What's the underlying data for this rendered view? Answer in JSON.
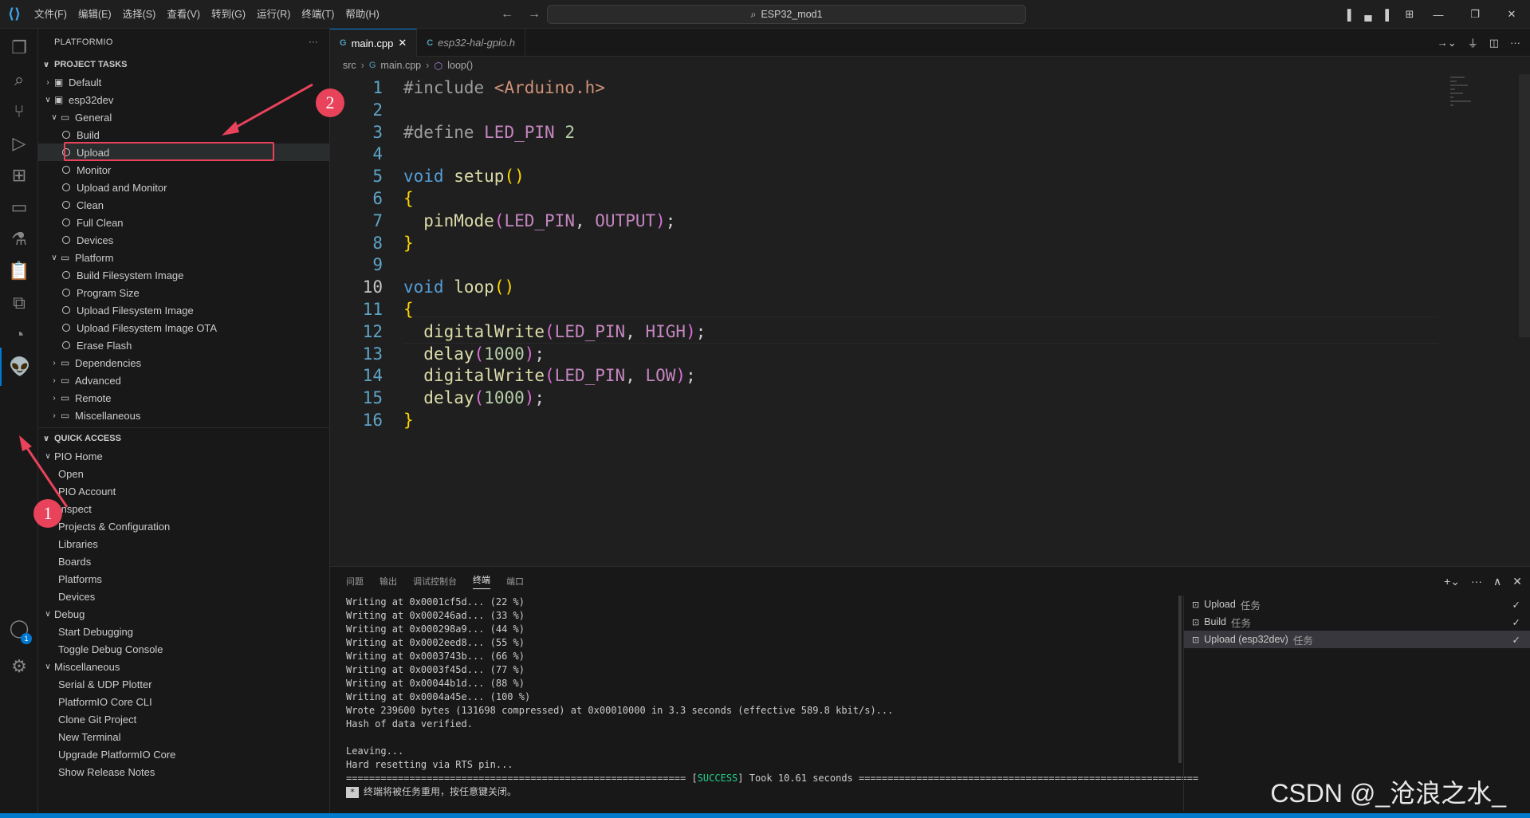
{
  "titlebar": {
    "menu": [
      "文件(F)",
      "编辑(E)",
      "选择(S)",
      "查看(V)",
      "转到(G)",
      "运行(R)",
      "终端(T)",
      "帮助(H)"
    ],
    "search": "ESP32_mod1"
  },
  "sidebar": {
    "header": "PLATFORMIO",
    "project_tasks": {
      "title": "PROJECT TASKS",
      "items": [
        {
          "label": "Default",
          "level": 1,
          "type": "env",
          "expanded": false
        },
        {
          "label": "esp32dev",
          "level": 1,
          "type": "env",
          "expanded": true
        },
        {
          "label": "General",
          "level": 2,
          "type": "folder",
          "expanded": true
        },
        {
          "label": "Build",
          "level": 3,
          "type": "task"
        },
        {
          "label": "Upload",
          "level": 3,
          "type": "task",
          "selected": true
        },
        {
          "label": "Monitor",
          "level": 3,
          "type": "task"
        },
        {
          "label": "Upload and Monitor",
          "level": 3,
          "type": "task"
        },
        {
          "label": "Clean",
          "level": 3,
          "type": "task"
        },
        {
          "label": "Full Clean",
          "level": 3,
          "type": "task"
        },
        {
          "label": "Devices",
          "level": 3,
          "type": "task"
        },
        {
          "label": "Platform",
          "level": 2,
          "type": "folder",
          "expanded": true
        },
        {
          "label": "Build Filesystem Image",
          "level": 3,
          "type": "task"
        },
        {
          "label": "Program Size",
          "level": 3,
          "type": "task"
        },
        {
          "label": "Upload Filesystem Image",
          "level": 3,
          "type": "task"
        },
        {
          "label": "Upload Filesystem Image OTA",
          "level": 3,
          "type": "task"
        },
        {
          "label": "Erase Flash",
          "level": 3,
          "type": "task"
        },
        {
          "label": "Dependencies",
          "level": 2,
          "type": "folder",
          "expanded": false
        },
        {
          "label": "Advanced",
          "level": 2,
          "type": "folder",
          "expanded": false
        },
        {
          "label": "Remote",
          "level": 2,
          "type": "folder",
          "expanded": false
        },
        {
          "label": "Miscellaneous",
          "level": 2,
          "type": "folder",
          "expanded": false
        }
      ]
    },
    "quick_access": {
      "title": "QUICK ACCESS",
      "groups": [
        {
          "label": "PIO Home",
          "items": [
            "Open",
            "PIO Account",
            "Inspect",
            "Projects & Configuration",
            "Libraries",
            "Boards",
            "Platforms",
            "Devices"
          ]
        },
        {
          "label": "Debug",
          "items": [
            "Start Debugging",
            "Toggle Debug Console"
          ]
        },
        {
          "label": "Miscellaneous",
          "items": [
            "Serial & UDP Plotter",
            "PlatformIO Core CLI",
            "Clone Git Project",
            "New Terminal",
            "Upgrade PlatformIO Core",
            "Show Release Notes"
          ]
        }
      ]
    }
  },
  "tabs": [
    {
      "label": "main.cpp",
      "active": true,
      "icon": "G"
    },
    {
      "label": "esp32-hal-gpio.h",
      "active": false,
      "icon": "C"
    }
  ],
  "breadcrumb": [
    "src",
    "main.cpp",
    "loop()"
  ],
  "code": [
    {
      "n": "1",
      "tokens": [
        [
          "pre",
          "#include "
        ],
        [
          "str",
          "<Arduino.h>"
        ]
      ]
    },
    {
      "n": "2",
      "tokens": []
    },
    {
      "n": "3",
      "tokens": [
        [
          "pre",
          "#define "
        ],
        [
          "macro",
          "LED_PIN"
        ],
        [
          "id",
          " "
        ],
        [
          "num",
          "2"
        ]
      ]
    },
    {
      "n": "4",
      "tokens": []
    },
    {
      "n": "5",
      "tokens": [
        [
          "kw",
          "void"
        ],
        [
          "id",
          " "
        ],
        [
          "fn",
          "setup"
        ],
        [
          "br",
          "()"
        ]
      ]
    },
    {
      "n": "6",
      "tokens": [
        [
          "br",
          "{"
        ]
      ]
    },
    {
      "n": "7",
      "tokens": [
        [
          "id",
          "  "
        ],
        [
          "fn",
          "pinMode"
        ],
        [
          "br2",
          "("
        ],
        [
          "macro",
          "LED_PIN"
        ],
        [
          "id",
          ", "
        ],
        [
          "macro",
          "OUTPUT"
        ],
        [
          "br2",
          ")"
        ],
        [
          "id",
          ";"
        ]
      ]
    },
    {
      "n": "8",
      "tokens": [
        [
          "br",
          "}"
        ]
      ]
    },
    {
      "n": "9",
      "tokens": []
    },
    {
      "n": "10",
      "tokens": [
        [
          "kw",
          "void"
        ],
        [
          "id",
          " "
        ],
        [
          "fn",
          "loop"
        ],
        [
          "br",
          "()"
        ]
      ],
      "current": true
    },
    {
      "n": "11",
      "tokens": [
        [
          "br",
          "{"
        ]
      ]
    },
    {
      "n": "12",
      "tokens": [
        [
          "id",
          "  "
        ],
        [
          "fn",
          "digitalWrite"
        ],
        [
          "br2",
          "("
        ],
        [
          "macro",
          "LED_PIN"
        ],
        [
          "id",
          ", "
        ],
        [
          "macro",
          "HIGH"
        ],
        [
          "br2",
          ")"
        ],
        [
          "id",
          ";"
        ]
      ]
    },
    {
      "n": "13",
      "tokens": [
        [
          "id",
          "  "
        ],
        [
          "fn",
          "delay"
        ],
        [
          "br2",
          "("
        ],
        [
          "num",
          "1000"
        ],
        [
          "br2",
          ")"
        ],
        [
          "id",
          ";"
        ]
      ]
    },
    {
      "n": "14",
      "tokens": [
        [
          "id",
          "  "
        ],
        [
          "fn",
          "digitalWrite"
        ],
        [
          "br2",
          "("
        ],
        [
          "macro",
          "LED_PIN"
        ],
        [
          "id",
          ", "
        ],
        [
          "macro",
          "LOW"
        ],
        [
          "br2",
          ")"
        ],
        [
          "id",
          ";"
        ]
      ]
    },
    {
      "n": "15",
      "tokens": [
        [
          "id",
          "  "
        ],
        [
          "fn",
          "delay"
        ],
        [
          "br2",
          "("
        ],
        [
          "num",
          "1000"
        ],
        [
          "br2",
          ")"
        ],
        [
          "id",
          ";"
        ]
      ]
    },
    {
      "n": "16",
      "tokens": [
        [
          "br",
          "}"
        ]
      ]
    }
  ],
  "panel": {
    "tabs": [
      "问题",
      "输出",
      "调试控制台",
      "终端",
      "端口"
    ],
    "active_tab": "终端",
    "terminal_lines": [
      "Writing at 0x0001cf5d... (22 %)",
      "Writing at 0x000246ad... (33 %)",
      "Writing at 0x000298a9... (44 %)",
      "Writing at 0x0002eed8... (55 %)",
      "Writing at 0x0003743b... (66 %)",
      "Writing at 0x0003f45d... (77 %)",
      "Writing at 0x00044b1d... (88 %)",
      "Writing at 0x0004a45e... (100 %)",
      "Wrote 239600 bytes (131698 compressed) at 0x00010000 in 3.3 seconds (effective 589.8 kbit/s)...",
      "Hash of data verified.",
      "",
      "Leaving...",
      "Hard resetting via RTS pin..."
    ],
    "success_line": {
      "left": "=========================================================== [",
      "status": "SUCCESS",
      "right": "] Took 10.61 seconds ==========================================================="
    },
    "notice": "终端将被任务重用，按任意键关闭。",
    "tasks": [
      {
        "label": "Upload",
        "suffix": "任务",
        "selected": false
      },
      {
        "label": "Build",
        "suffix": "任务",
        "selected": false
      },
      {
        "label": "Upload (esp32dev)",
        "suffix": "任务",
        "selected": true
      }
    ]
  },
  "annotations": {
    "one": "1",
    "two": "2"
  },
  "watermark": "CSDN @_沧浪之水_",
  "colors": {
    "accent": "#0078d4",
    "annotation_red": "#e8435a",
    "status_bar": "#007acc"
  }
}
